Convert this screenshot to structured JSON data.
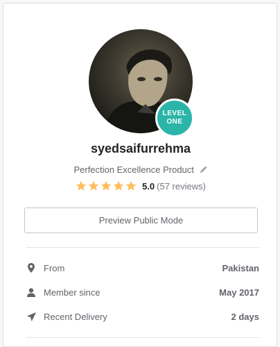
{
  "profile": {
    "avatar_badge": {
      "line1": "LEVEL",
      "line2": "ONE"
    },
    "username": "syedsaifurrehma",
    "tagline": "Perfection Excellence Product",
    "rating": {
      "stars": 5,
      "score": "5.0",
      "reviews": "(57 reviews)"
    },
    "preview_button": "Preview Public Mode",
    "stats": [
      {
        "icon": "location-pin-icon",
        "label": "From",
        "value": "Pakistan"
      },
      {
        "icon": "user-icon",
        "label": "Member since",
        "value": "May 2017"
      },
      {
        "icon": "paper-plane-icon",
        "label": "Recent Delivery",
        "value": "2 days"
      }
    ]
  },
  "colors": {
    "badge": "#2bb5a8",
    "star": "#ffbe5b",
    "text": "#222325",
    "muted": "#62646a"
  }
}
